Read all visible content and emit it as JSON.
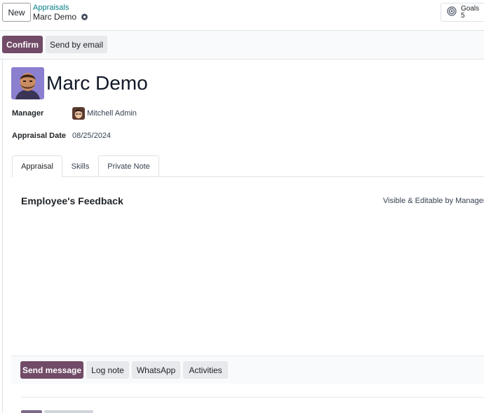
{
  "control_panel": {
    "new_label": "New",
    "breadcrumb_parent": "Appraisals",
    "breadcrumb_current": "Marc Demo",
    "goals_label": "Goals",
    "goals_count": "5"
  },
  "status_bar": {
    "confirm_label": "Confirm",
    "send_email_label": "Send by email"
  },
  "record": {
    "name": "Marc Demo",
    "manager_label": "Manager",
    "manager_value": "Mitchell Admin",
    "date_label": "Appraisal Date",
    "date_value": "08/25/2024"
  },
  "tabs": [
    {
      "label": "Appraisal"
    },
    {
      "label": "Skills"
    },
    {
      "label": "Private Note"
    }
  ],
  "feedback": {
    "title": "Employee's Feedback",
    "visibility": "Visible & Editable by Manager"
  },
  "chatter": {
    "send_message": "Send message",
    "log_note": "Log note",
    "whatsapp": "WhatsApp",
    "activities": "Activities"
  },
  "colors": {
    "primary": "#714b67",
    "link": "#017e84"
  },
  "icons": {
    "gear": "gear-icon",
    "goals": "target-icon"
  }
}
